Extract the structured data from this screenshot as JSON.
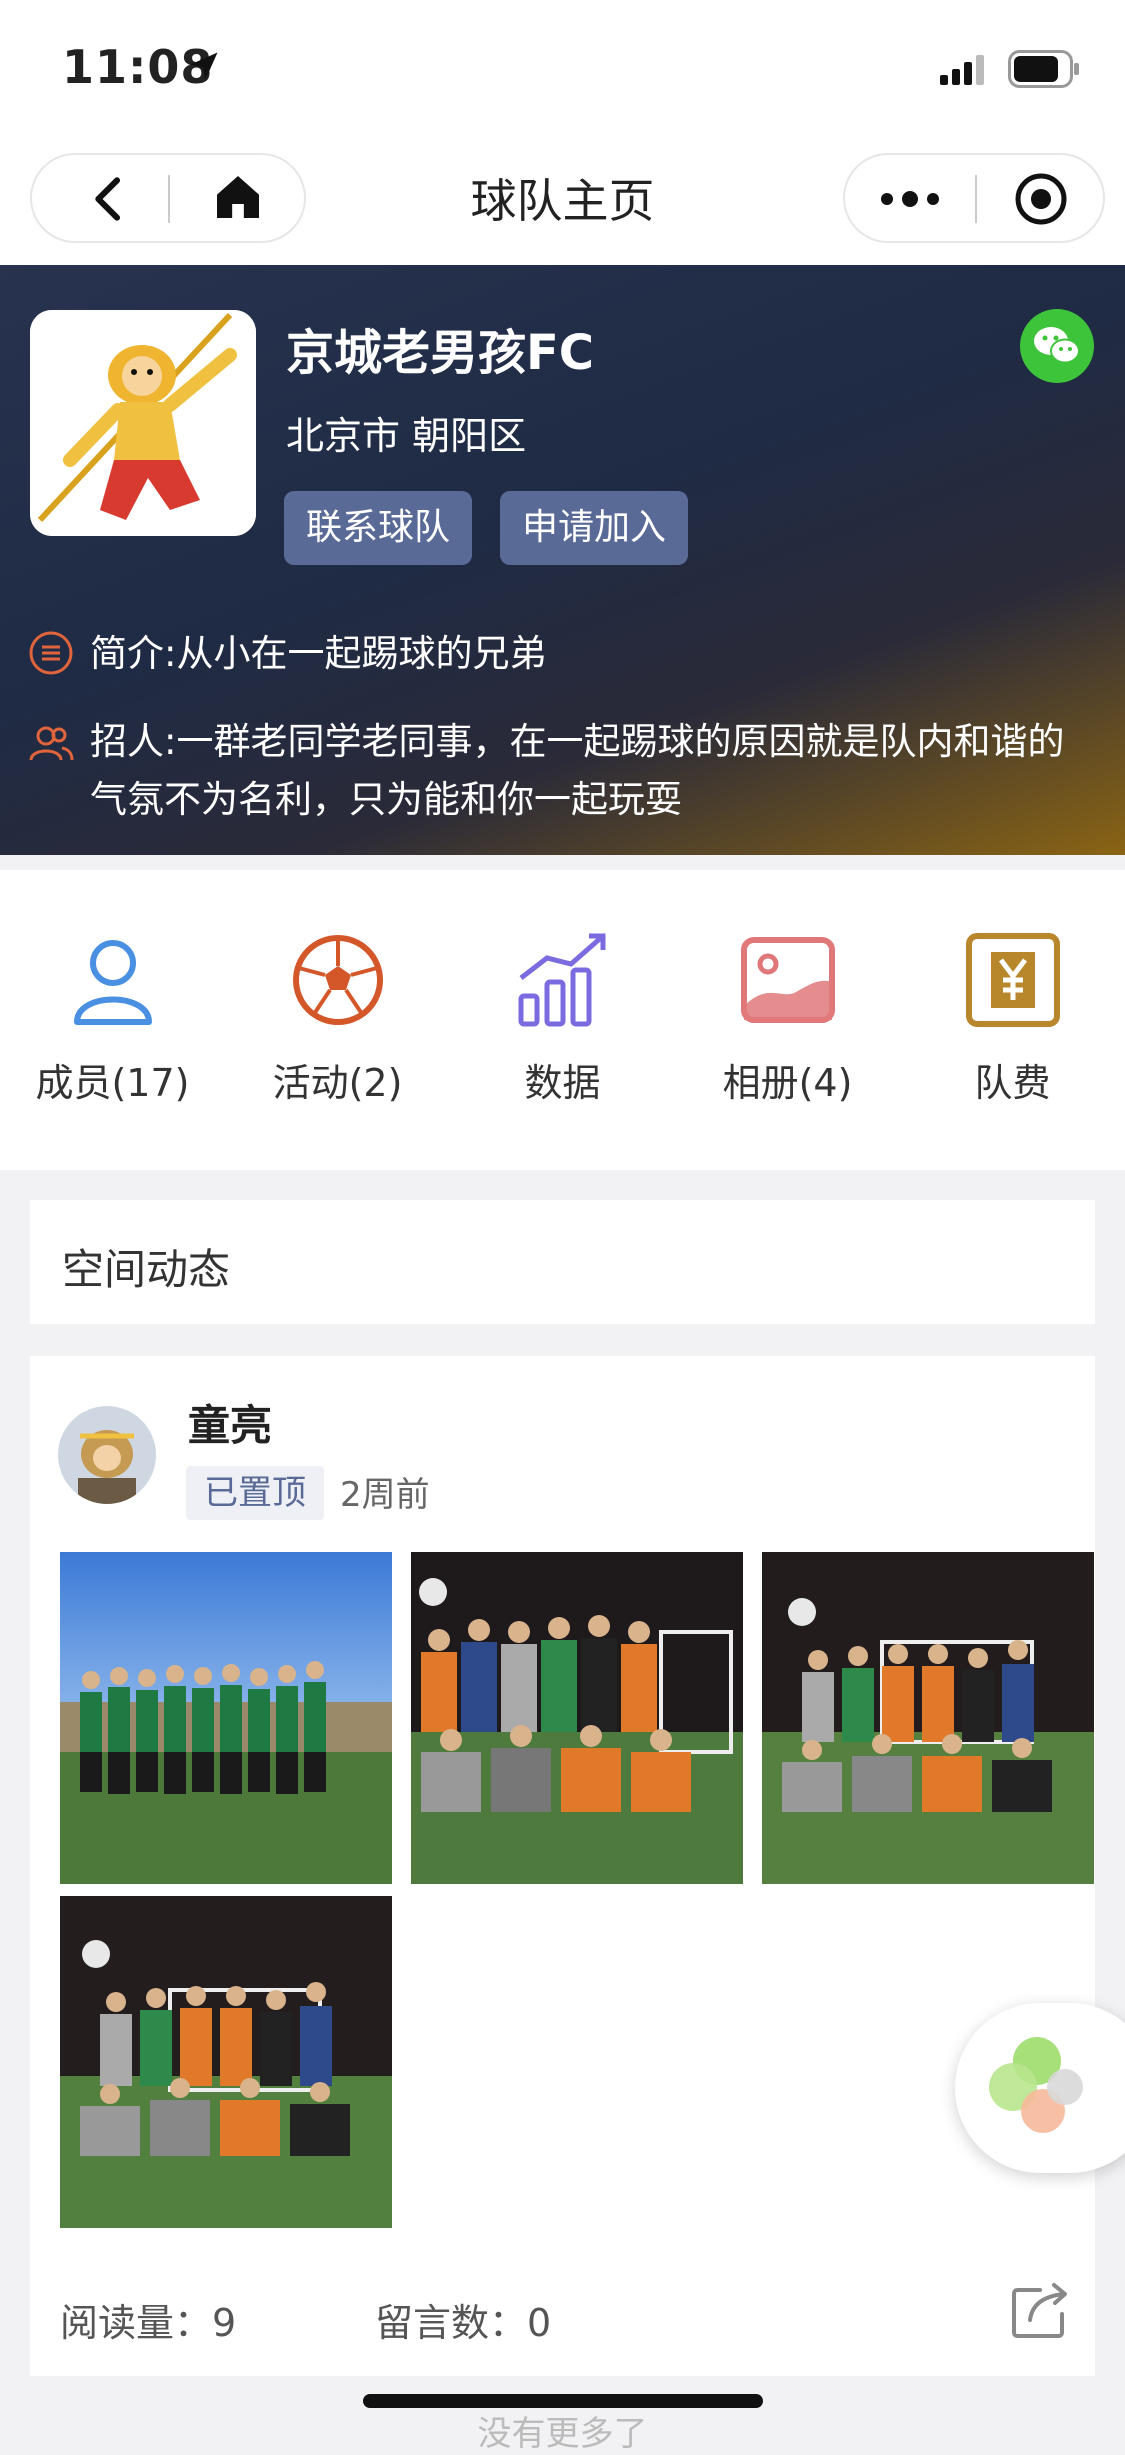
{
  "status_bar": {
    "time": "11:08"
  },
  "nav": {
    "title": "球队主页"
  },
  "team": {
    "name": "京城老男孩FC",
    "location": "北京市 朝阳区",
    "contact_label": "联系球队",
    "join_label": "申请加入",
    "intro": "简介:从小在一起踢球的兄弟",
    "recruit": "招人:一群老同学老同事，在一起踢球的原因就是队内和谐的气氛不为名利，只为能和你一起玩耍"
  },
  "menu": {
    "items": [
      {
        "label": "成员(17)",
        "icon": "person-icon",
        "color": "#4a90e2"
      },
      {
        "label": "活动(2)",
        "icon": "soccer-ball-icon",
        "color": "#d4572a"
      },
      {
        "label": "数据",
        "icon": "bar-chart-icon",
        "color": "#7b6be0"
      },
      {
        "label": "相册(4)",
        "icon": "photo-album-icon",
        "color": "#e0787a"
      },
      {
        "label": "队费",
        "icon": "yen-icon",
        "color": "#b8862b"
      }
    ]
  },
  "feed": {
    "section_title": "空间动态",
    "post": {
      "author": "童亮",
      "pinned_label": "已置顶",
      "time": "2周前",
      "read_count": "阅读量：9",
      "comment_count": "留言数：0"
    },
    "footer": "没有更多了"
  }
}
